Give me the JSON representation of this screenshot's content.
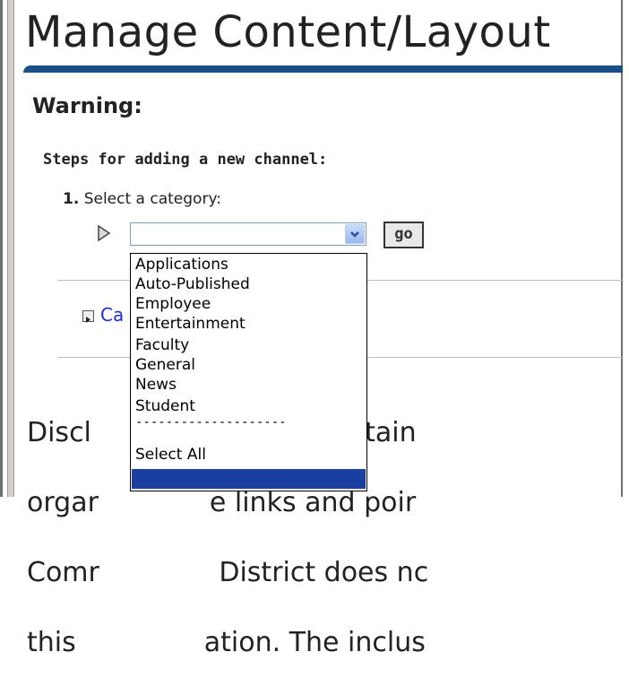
{
  "page": {
    "title": "Manage Content/Layout",
    "warning_title": "Warning:",
    "steps_heading": "Steps for adding a new channel:",
    "step_one_number": "1.",
    "step_one_label": "Select a category:",
    "go_label": "go",
    "channel_link": "Ca",
    "disclaimer_lines": [
      "Discl             hannels contain",
      "orgar             e links and poir",
      "Comr              District does nc",
      "this               ation. The inclus"
    ]
  },
  "category_select": {
    "value": "",
    "options": [
      "Applications",
      "Auto-Published",
      "Employee",
      "Entertainment",
      "Faculty",
      "General",
      "News",
      "Student",
      "--------------------",
      "Select All",
      ""
    ],
    "highlighted_index": 10
  },
  "colors": {
    "title_rule": "#1b4f8a",
    "link": "#1d2dd6",
    "highlight": "#1a3fa0"
  }
}
